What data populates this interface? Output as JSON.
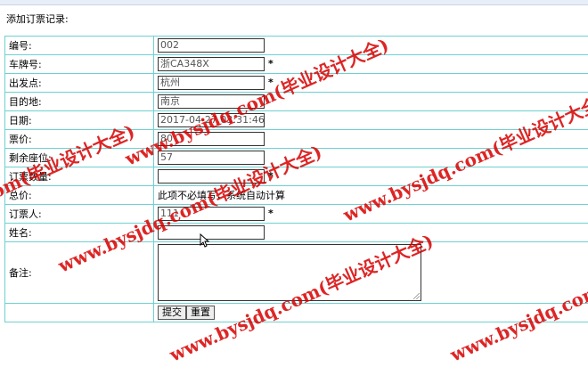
{
  "page_title": "添加订票记录:",
  "form": {
    "fields": [
      {
        "label": "编号:",
        "value": "002"
      },
      {
        "label": "车牌号:",
        "value": "浙CA348X",
        "required": "*"
      },
      {
        "label": "出发点:",
        "value": "杭州",
        "required": "*"
      },
      {
        "label": "目的地:",
        "value": "南京"
      },
      {
        "label": "日期:",
        "value": "2017-04-27 03:31:46"
      },
      {
        "label": "票价:",
        "value": "80"
      },
      {
        "label": "剩余座位:",
        "value": "57"
      },
      {
        "label": "订票数量:",
        "value": "",
        "required": "*"
      },
      {
        "label": "总价:",
        "text": "此项不必填写，系统自动计算"
      },
      {
        "label": "订票人:",
        "value": "111",
        "required": "*"
      },
      {
        "label": "姓名:",
        "value": ""
      },
      {
        "label": "备注:",
        "value": ""
      }
    ],
    "submit_label": "提交",
    "reset_label": "重置"
  },
  "watermarks": [
    "www.bysjdq.com(毕业设计大全)"
  ]
}
